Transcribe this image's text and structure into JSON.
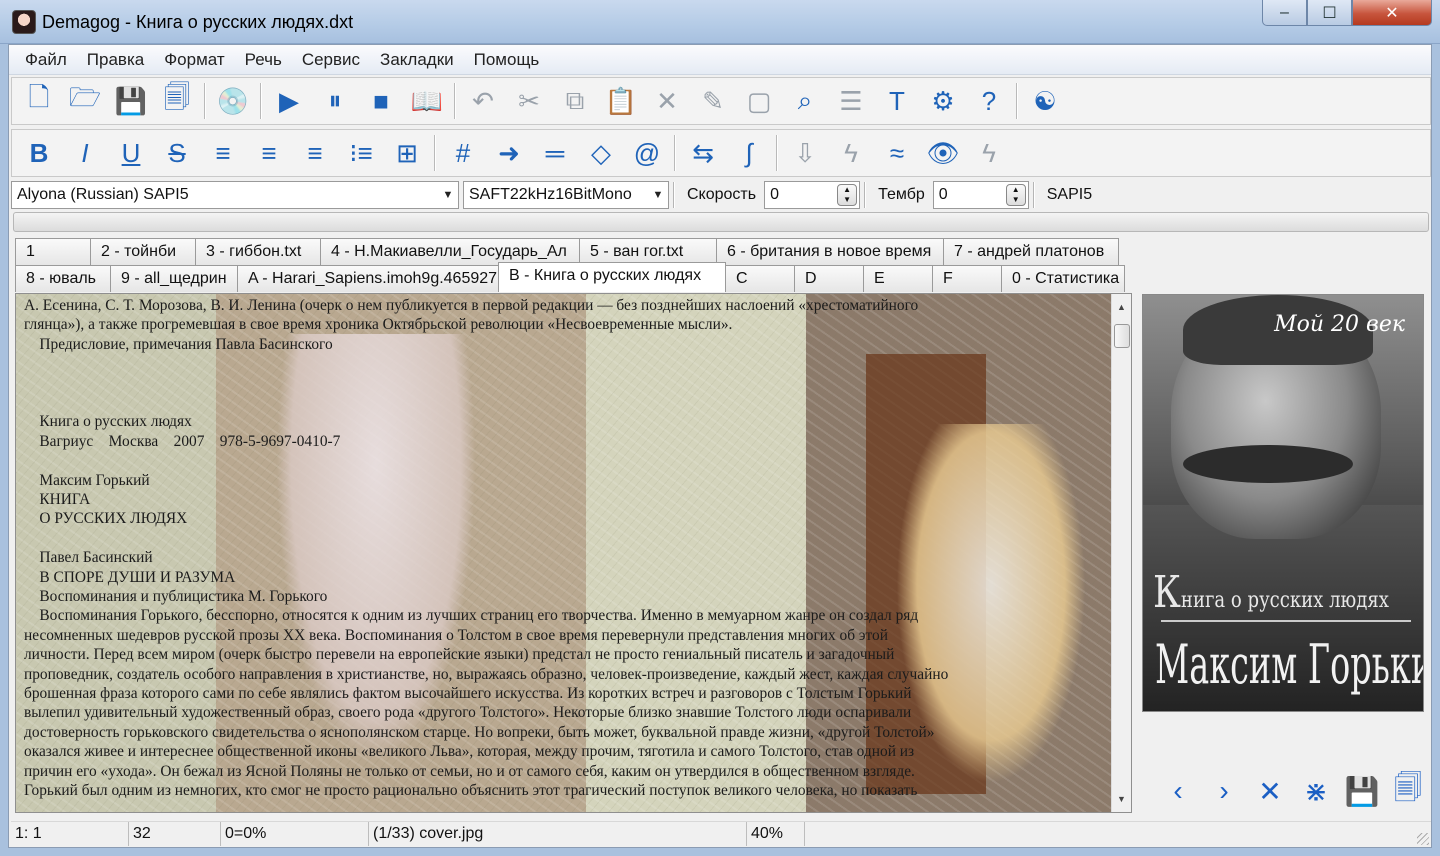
{
  "window": {
    "title": "Demagog - Книга о русских людях.dxt",
    "min": "‒",
    "max": "☐",
    "close": "✕"
  },
  "menu": [
    "Файл",
    "Правка",
    "Формат",
    "Речь",
    "Сервис",
    "Закладки",
    "Помощь"
  ],
  "toolbar1": [
    {
      "name": "new-document-icon",
      "glyph": "🗋"
    },
    {
      "name": "open-folder-icon",
      "glyph": "🗁"
    },
    {
      "name": "save-icon",
      "glyph": "💾"
    },
    {
      "name": "save-all-icon",
      "glyph": "🗐"
    },
    {
      "sep": true
    },
    {
      "name": "cd-disc-icon",
      "glyph": "💿"
    },
    {
      "sep": true
    },
    {
      "name": "play-icon",
      "glyph": "▶"
    },
    {
      "name": "pause-icon",
      "glyph": "⏸"
    },
    {
      "name": "stop-icon",
      "glyph": "■"
    },
    {
      "name": "book-icon",
      "glyph": "📖"
    },
    {
      "sep": true
    },
    {
      "name": "undo-icon",
      "glyph": "↶"
    },
    {
      "name": "cut-icon",
      "glyph": "✂"
    },
    {
      "name": "copy-icon",
      "glyph": "⧉"
    },
    {
      "name": "paste-icon",
      "glyph": "📋"
    },
    {
      "name": "delete-icon",
      "glyph": "✕"
    },
    {
      "name": "edit-icon",
      "glyph": "✎"
    },
    {
      "name": "select-all-icon",
      "glyph": "▢"
    },
    {
      "name": "find-binoculars-icon",
      "glyph": "⌕"
    },
    {
      "name": "list-document-icon",
      "glyph": "☰"
    },
    {
      "name": "text-format-icon",
      "glyph": "T"
    },
    {
      "name": "settings-gear-icon",
      "glyph": "⚙"
    },
    {
      "name": "help-icon",
      "glyph": "?"
    },
    {
      "sep": true
    },
    {
      "name": "yin-yang-icon",
      "glyph": "☯"
    }
  ],
  "toolbar2": [
    {
      "name": "bold-icon",
      "glyph": "B"
    },
    {
      "name": "italic-icon",
      "glyph": "I"
    },
    {
      "name": "underline-icon",
      "glyph": "U"
    },
    {
      "name": "strikethrough-icon",
      "glyph": "S"
    },
    {
      "name": "align-left-icon",
      "glyph": "≡"
    },
    {
      "name": "align-center-icon",
      "glyph": "≡"
    },
    {
      "name": "align-right-icon",
      "glyph": "≡"
    },
    {
      "name": "bullet-list-icon",
      "glyph": "⁝≡"
    },
    {
      "name": "table-icon",
      "glyph": "⊞"
    },
    {
      "sep": true
    },
    {
      "name": "hash-icon",
      "glyph": "#"
    },
    {
      "name": "arrow-right-icon",
      "glyph": "➜"
    },
    {
      "name": "equals-icon",
      "glyph": "═"
    },
    {
      "name": "diamond-icon",
      "glyph": "◇"
    },
    {
      "name": "at-sign-icon",
      "glyph": "@"
    },
    {
      "sep": true
    },
    {
      "name": "replace-icon",
      "glyph": "⇆"
    },
    {
      "name": "integral-icon",
      "glyph": "∫"
    },
    {
      "sep": true
    },
    {
      "name": "download-arrow-icon",
      "glyph": "⇩"
    },
    {
      "name": "lightning-icon",
      "glyph": "ϟ"
    },
    {
      "name": "approx-icon",
      "glyph": "≈"
    },
    {
      "name": "eye-icon",
      "glyph": "👁"
    },
    {
      "name": "lightning-document-icon",
      "glyph": "ϟ"
    }
  ],
  "voice": {
    "voice_name": "Alyona (Russian) SAPI5",
    "audio_format": "SAFT22kHz16BitMono",
    "speed_label": "Скорость",
    "speed_value": "0",
    "timbre_label": "Тембр",
    "timbre_value": "0",
    "engine": "SAPI5"
  },
  "tabs_row1": [
    "1",
    "2 - тойнби",
    "3 - гиббон.txt",
    "4 - Н.Макиавелли_Государь_Ал",
    "5 - ван гог.txt",
    "6 - британия в новое время",
    "7 - андрей платонов"
  ],
  "tabs_row2": [
    "8 - юваль",
    "9 - all_щедрин",
    "A - Harari_Sapiens.imoh9g.465927",
    "B - Книга о русских людях",
    "C",
    "D",
    "E",
    "F",
    "0 - Статистика"
  ],
  "document": {
    "lines": [
      "А. Есенина, С. Т. Морозова, В. И. Ленина (очерк о нем публикуется в первой редакции — без позднейших наслоений «хрестоматийного",
      "глянца»), а также прогремевшая в свое время хроника Октябрьской революции «Несвоевременные мысли».",
      "    Предисловие, примечания Павла Басинского",
      "",
      "",
      "",
      "    Книга о русских людях",
      "    Вагриус    Москва    2007    978-5-9697-0410-7",
      "",
      "    Максим Горький",
      "    КНИГА",
      "    О РУССКИХ ЛЮДЯХ",
      "",
      "    Павел Басинский",
      "    В СПОРЕ ДУШИ И РАЗУМА",
      "    Воспоминания и публицистика М. Горького",
      "    Воспоминания Горького, бесспорно, относятся к одним из лучших страниц его творчества. Именно в мемуарном жанре он создал ряд",
      "несомненных шедевров русской прозы XX века. Воспоминания о Толстом в свое время перевернули представления многих об этой",
      "личности. Перед всем миром (очерк быстро перевели на европейские языки) предстал не просто гениальный писатель и загадочный",
      "проповедник, создатель особого направления в христианстве, но, выражаясь образно, человек-произведение, каждый жест, каждая случайно",
      "брошенная фраза которого сами по себе являлись фактом высочайшего искусства. Из коротких встреч и разговоров с Толстым Горький",
      "вылепил удивительный художественный образ, своего рода «другого Толстого». Некоторые близко знавшие Толстого люди оспаривали",
      "достоверность горьковского свидетельства о яснополянском старце. Но вопреки, быть может, буквальной правде жизни, «другой Толстой»",
      "оказался живее и интереснее общественной иконы «великого Льва», которая, между прочим, тяготила и самого Толстого, став одной из",
      "причин его «ухода». Он бежал из Ясной Поляны не только от семьи, но и от самого себя, каким он утвердился в общественном взгляде.",
      "Горький был одним из немногих, кто смог не просто рационально объяснить этот трагический поступок великого человека, но показать"
    ]
  },
  "cover": {
    "series": "Мой 20 век",
    "title_initial": "К",
    "title_rest": "нига о русских людях",
    "author": "Максим Горький"
  },
  "cover_nav": [
    {
      "name": "previous-image-icon",
      "glyph": "‹"
    },
    {
      "name": "next-image-icon",
      "glyph": "›"
    },
    {
      "name": "remove-image-icon",
      "glyph": "✕"
    },
    {
      "name": "remove-all-images-icon",
      "glyph": "⋇"
    },
    {
      "name": "save-image-icon",
      "glyph": "💾"
    },
    {
      "name": "save-all-images-icon",
      "glyph": "🗐"
    }
  ],
  "status": {
    "position": "1: 1",
    "count": "32",
    "percent_pos": "0=0%",
    "image": "(1/33) cover.jpg",
    "zoom": "40%"
  }
}
